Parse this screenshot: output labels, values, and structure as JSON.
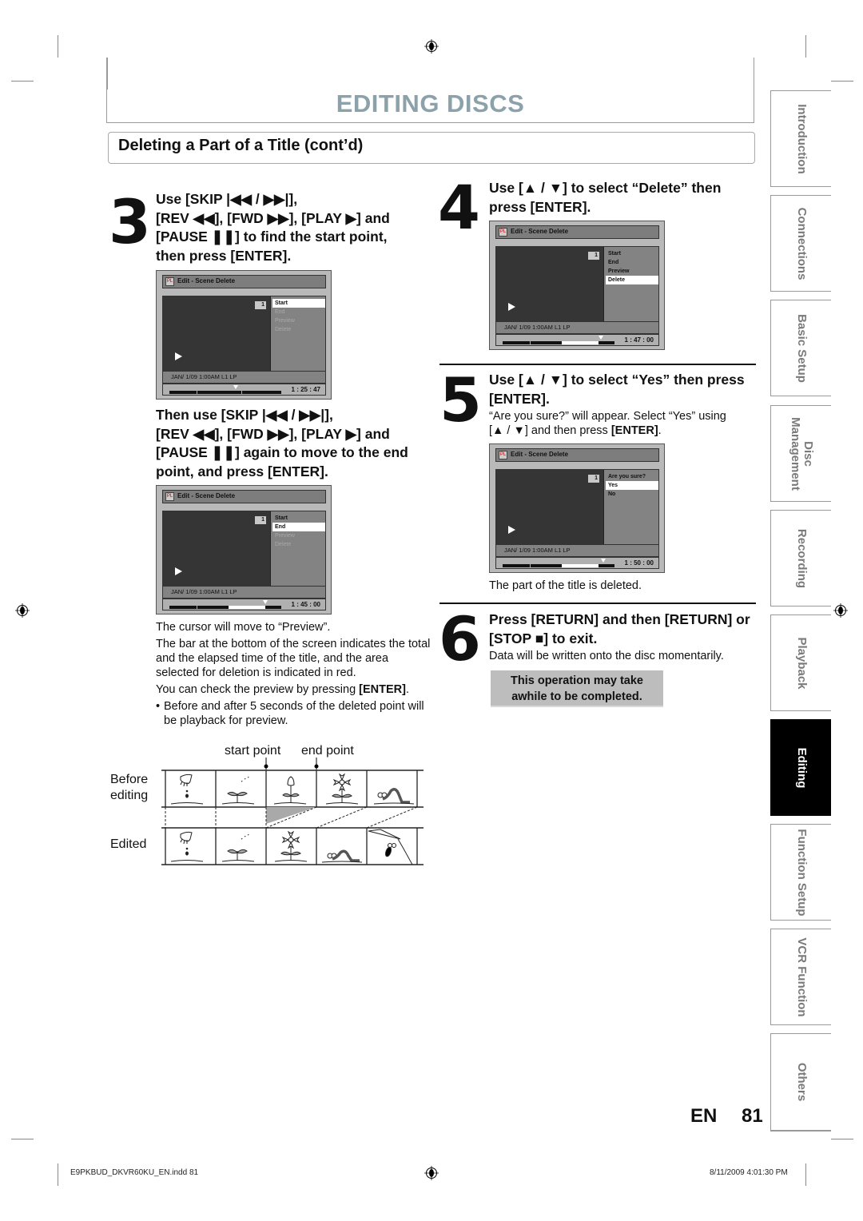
{
  "page": {
    "title": "EDITING DISCS",
    "section_title": "Deleting a Part of a Title (cont’d)",
    "page_lang": "EN",
    "page_number": "81"
  },
  "step3": {
    "number": "3",
    "heading_lines": [
      "Use [SKIP |◀◀ / ▶▶|],",
      "[REV ◀◀], [FWD ▶▶], [PLAY ▶] and",
      "[PAUSE ❚❚] to find the start point,",
      "then press [ENTER]."
    ],
    "screen": {
      "title": "Edit - Scene Delete",
      "chip": "1",
      "menu": [
        {
          "label": "Start",
          "state": "selected"
        },
        {
          "label": "End",
          "state": "dim"
        },
        {
          "label": "Preview",
          "state": "dim"
        },
        {
          "label": "Delete",
          "state": "dim"
        }
      ],
      "info": "JAN/ 1/09 1:00AM L1   LP",
      "time": "1 : 25 : 47",
      "marker_position": 0.59
    },
    "subheading_lines": [
      "Then use [SKIP |◀◀ / ▶▶|],",
      "[REV ◀◀], [FWD ▶▶], [PLAY ▶] and",
      "[PAUSE ❚❚] again to move to the end",
      "point, and press [ENTER]."
    ],
    "screen2": {
      "title": "Edit - Scene Delete",
      "chip": "1",
      "menu": [
        {
          "label": "Start",
          "state": "normal"
        },
        {
          "label": "End",
          "state": "selected"
        },
        {
          "label": "Preview",
          "state": "dim"
        },
        {
          "label": "Delete",
          "state": "dim"
        }
      ],
      "info": "JAN/ 1/09 1:00AM L1   LP",
      "time": "1 : 45 : 00",
      "selection_range": [
        0.53,
        0.86
      ],
      "marker_position": 0.86
    },
    "notes": [
      "The cursor will move to “Preview”.",
      "The bar at the bottom of the screen indicates the total and the elapsed time of the title, and the area selected for deletion is indicated in red.",
      "You can check the preview by pressing ",
      "[ENTER]",
      "."
    ],
    "bullet": "Before and after 5 seconds of the deleted point will be playback for preview."
  },
  "diagram": {
    "start_label": "start point",
    "end_label": "end point",
    "before_label": "Before editing",
    "edited_label": "Edited",
    "before_frames": [
      "hand-sowing-seed",
      "sprout-watered",
      "tulip-bud",
      "flower-bloom",
      "caterpillar"
    ],
    "edited_frames": [
      "hand-sowing-seed",
      "sprout-watered",
      "flower-bloom",
      "caterpillar",
      "bird-beak"
    ]
  },
  "step4": {
    "number": "4",
    "heading_lines": [
      "Use [▲ / ▼] to select “Delete” then",
      "press [ENTER]."
    ],
    "screen": {
      "title": "Edit - Scene Delete",
      "chip": "1",
      "menu": [
        {
          "label": "Start",
          "state": "normal"
        },
        {
          "label": "End",
          "state": "normal"
        },
        {
          "label": "Preview",
          "state": "normal"
        },
        {
          "label": "Delete",
          "state": "selected"
        }
      ],
      "info": "JAN/ 1/09 1:00AM L1   LP",
      "time": "1 : 47 : 00",
      "selection_range": [
        0.53,
        0.86
      ],
      "marker_position": 0.88
    }
  },
  "step5": {
    "number": "5",
    "heading_lines": [
      "Use [▲ / ▼] to select “Yes” then press",
      "[ENTER]."
    ],
    "body_line1": "“Are you sure?” will appear. Select “Yes” using",
    "body_line2_pre": "[▲ / ▼] and then press ",
    "body_line2_bold": "[ENTER]",
    "body_line2_post": ".",
    "screen": {
      "title": "Edit - Scene Delete",
      "chip": "1",
      "menu": [
        {
          "label": "Are you sure?",
          "state": "normal"
        },
        {
          "label": "Yes",
          "state": "selected"
        },
        {
          "label": "No",
          "state": "normal"
        }
      ],
      "info": "JAN/ 1/09 1:00AM L1   LP",
      "time": "1 : 50 : 00",
      "selection_range": [
        0.53,
        0.86
      ],
      "marker_position": 0.9
    },
    "result": "The part of the title is deleted."
  },
  "step6": {
    "number": "6",
    "heading_lines": [
      "Press [RETURN] and then [RETURN] or",
      "[STOP ■] to exit."
    ],
    "body": "Data will be written onto the disc momentarily.",
    "note_lines": [
      "This operation may take",
      "awhile to be completed."
    ]
  },
  "side_tabs": [
    {
      "label": "Introduction",
      "active": false
    },
    {
      "label": "Connections",
      "active": false
    },
    {
      "label": "Basic Setup",
      "active": false
    },
    {
      "label": "Disc Management",
      "active": false
    },
    {
      "label": "Recording",
      "active": false
    },
    {
      "label": "Playback",
      "active": false
    },
    {
      "label": "Editing",
      "active": true
    },
    {
      "label": "Function Setup",
      "active": false
    },
    {
      "label": "VCR Function",
      "active": false
    },
    {
      "label": "Others",
      "active": false
    }
  ],
  "footer": {
    "file": "E9PKBUD_DKVR60KU_EN.indd   81",
    "date": "8/11/2009   4:01:30 PM"
  },
  "colors": {
    "title": "#8ba2ab",
    "active_tab": "#000000",
    "inactive_tab_text": "#7a7a7a",
    "note_box": "#bdbdbd"
  }
}
